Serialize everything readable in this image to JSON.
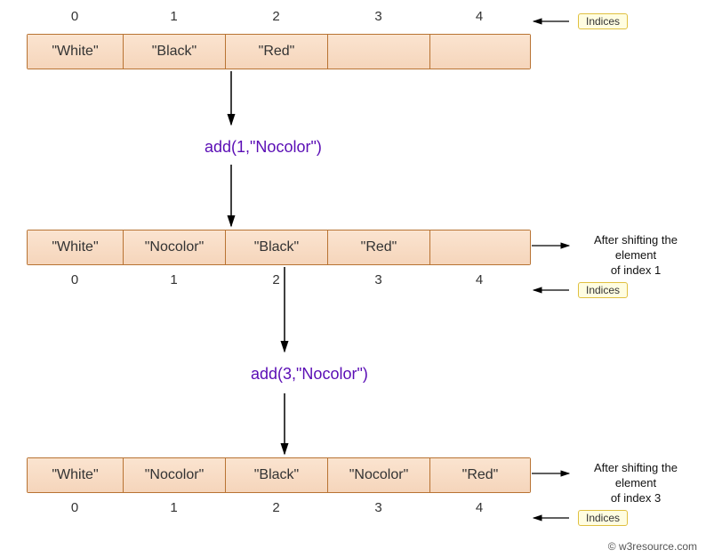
{
  "indices": [
    "0",
    "1",
    "2",
    "3",
    "4"
  ],
  "indices_label": "Indices",
  "array1": [
    "\"White\"",
    "\"Black\"",
    "\"Red\"",
    "",
    ""
  ],
  "call1": "add(1,\"Nocolor\")",
  "array2": [
    "\"White\"",
    "\"Nocolor\"",
    "\"Black\"",
    "\"Red\"",
    ""
  ],
  "annotation2a": "After shifting the element",
  "annotation2b": "of index 1",
  "call2": "add(3,\"Nocolor\")",
  "array3": [
    "\"White\"",
    "\"Nocolor\"",
    "\"Black\"",
    "\"Nocolor\"",
    "\"Red\""
  ],
  "annotation3a": "After shifting the element",
  "annotation3b": "of index 3",
  "footer": "© w3resource.com",
  "cell_widths": [
    108,
    115,
    115,
    115,
    112
  ]
}
